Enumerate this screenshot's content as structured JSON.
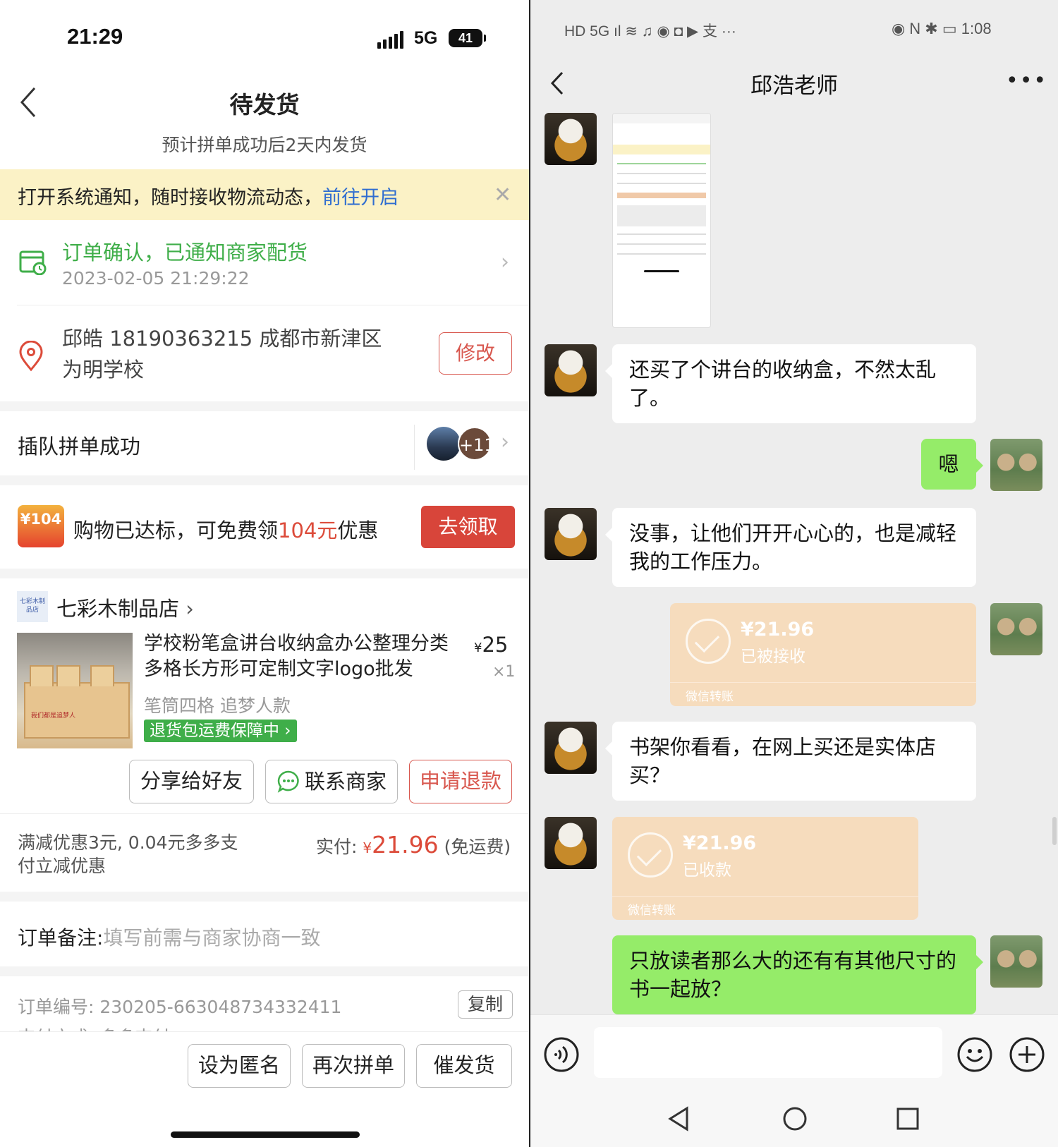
{
  "left": {
    "status": {
      "time": "21:29",
      "network": "5G",
      "battery": "41"
    },
    "title": "待发货",
    "subtitle": "预计拼单成功后2天内发货",
    "notice": {
      "text": "打开系统通知，随时接收物流动态，",
      "link": "前往开启"
    },
    "order_status": {
      "title": "订单确认，已通知商家配货",
      "time": "2023-02-05 21:29:22"
    },
    "address": {
      "text": "邱皓  18190363215  成都市新津区为明学校",
      "edit": "修改"
    },
    "group": {
      "label": "插队拼单成功",
      "count": "+11"
    },
    "coupon": {
      "badge": "¥104",
      "text_prefix": "购物已达标，可免费领",
      "amount": "104元",
      "text_suffix": "优惠",
      "button": "去领取"
    },
    "shop": {
      "logo_text": "七彩木制品店",
      "name": "七彩木制品店"
    },
    "product": {
      "title": "学校粉笔盒讲台收纳盒办公整理分类多格长方形可定制文字logo批发",
      "currency": "¥",
      "price": "25",
      "qty": "×1",
      "spec": "笔筒四格 追梦人款",
      "tag": "退货包运费保障中",
      "image_text": "我们都是追梦人"
    },
    "actions": {
      "share": "分享给好友",
      "contact": "联系商家",
      "refund": "申请退款"
    },
    "payment": {
      "discount": "满减优惠3元, 0.04元多多支付立减优惠",
      "paid_label": "实付:",
      "currency": "¥",
      "amount": "21.96",
      "shipping": "(免运费)"
    },
    "note": {
      "label": "订单备注:",
      "placeholder": "填写前需与商家协商一致"
    },
    "order": {
      "number": "订单编号: 230205-663048734332411",
      "copy": "复制",
      "pay_mode": "支付方式: 多多支付 >"
    },
    "bottom": {
      "anonymous": "设为匿名",
      "again": "再次拼单",
      "urge": "催发货"
    }
  },
  "right": {
    "status": {
      "left": "HD 5G ıl ≋ ♫ ◉ ◘ ▶ 支 ···",
      "right": "◉ N ✱ ▭ 1:08"
    },
    "title": "邱浩老师",
    "messages": [
      {
        "side": "left",
        "type": "image"
      },
      {
        "side": "left",
        "type": "text",
        "text": "还买了个讲台的收纳盒，不然太乱了。"
      },
      {
        "side": "right",
        "type": "text",
        "text": "嗯"
      },
      {
        "side": "left",
        "type": "text",
        "text": "没事，让他们开开心心的，也是减轻我的工作压力。"
      },
      {
        "side": "right",
        "type": "transfer",
        "amount": "¥21.96",
        "status": "已被接收",
        "label": "微信转账"
      },
      {
        "side": "left",
        "type": "text",
        "text": "书架你看看，在网上买还是实体店买？"
      },
      {
        "side": "left",
        "type": "transfer",
        "amount": "¥21.96",
        "status": "已收款",
        "label": "微信转账"
      },
      {
        "side": "right",
        "type": "text",
        "text": "只放读者那么大的还有有其他尺寸的书一起放？"
      }
    ]
  },
  "colors": {
    "accent_red": "#d8453a",
    "green": "#3fae49",
    "wechat_green": "#95ec69",
    "transfer": "#f6dcbd",
    "link_blue": "#2f6dd0"
  }
}
